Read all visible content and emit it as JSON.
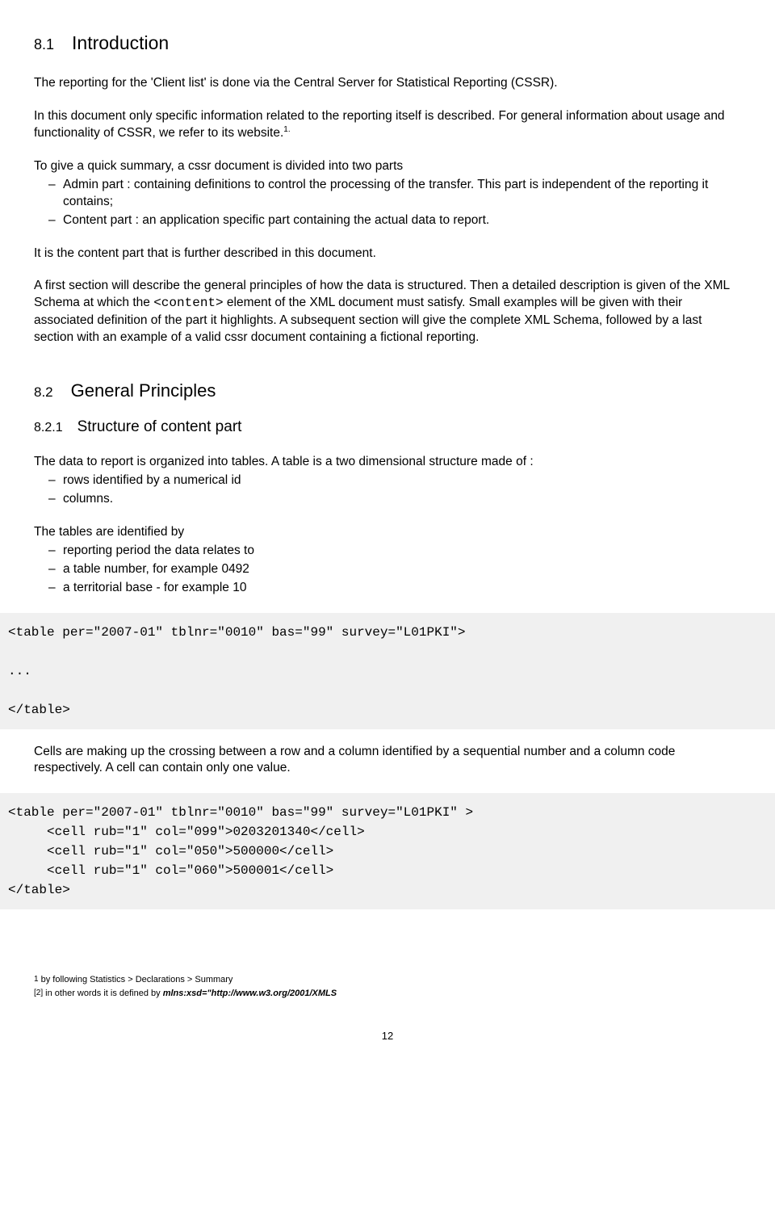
{
  "sec81": {
    "num": "8.1",
    "title": "Introduction"
  },
  "p1": "The reporting for the 'Client list' is done via the Central Server for Statistical Reporting (CSSR).",
  "p2a": "In this document only specific information related to the reporting itself is described. For general information about usage and functionality of CSSR, we refer to its website.",
  "sup1": "1.",
  "p3_intro": "To give a quick summary, a cssr document is divided into two parts",
  "li_admin": "Admin part : containing definitions to control the processing of the transfer. This part is independent of the reporting it contains;",
  "li_content": "Content part : an application specific part containing the actual data to report.",
  "p4": "It is the content part that is further described in this document.",
  "p5a": "A first section will describe the general principles of how the data is structured. Then a detailed description is given of the XML Schema at which the ",
  "p5_code": "<content>",
  "p5b": " element of the XML document must satisfy. Small examples will be given with their associated definition of the part it highlights. A subsequent section will give the complete XML Schema, followed by a last section with an example of a valid cssr document containing a fictional reporting.",
  "sec82": {
    "num": "8.2",
    "title": "General Principles"
  },
  "sec821": {
    "num": "8.2.1",
    "title": "Structure of content part"
  },
  "p6": "The data to report is organized into tables. A table is a two dimensional structure made of :",
  "li_rows": "rows identified by a numerical id",
  "li_cols": "columns.",
  "p7": "The tables are identified by",
  "li_period": "reporting period the data relates to",
  "li_tblnum": "a table number, for example 0492",
  "li_terr": "a territorial base - for example 10",
  "code1": "<table per=\"2007-01\" tblnr=\"0010\" bas=\"99\" survey=\"L01PKI\">\n\n...\n\n</table>",
  "p8": "Cells are making up the crossing between a row and a column identified by a sequential number and a column code respectively. A cell can contain only one value.",
  "code2": "<table per=\"2007-01\" tblnr=\"0010\" bas=\"99\" survey=\"L01PKI\" >\n     <cell rub=\"1\" col=\"099\">0203201340</cell>\n     <cell rub=\"1\" col=\"050\">500000</cell>\n     <cell rub=\"1\" col=\"060\">500001</cell>\n</table>",
  "fn1": {
    "marker": "1",
    "text": " by following Statistics > Declarations > Summary"
  },
  "fn2": {
    "marker": "[2]",
    "text_a": " in other words it is defined by ",
    "italic": "mlns:xsd=\"http://www.w3.org/2001/XMLS"
  },
  "pagenum": "12"
}
